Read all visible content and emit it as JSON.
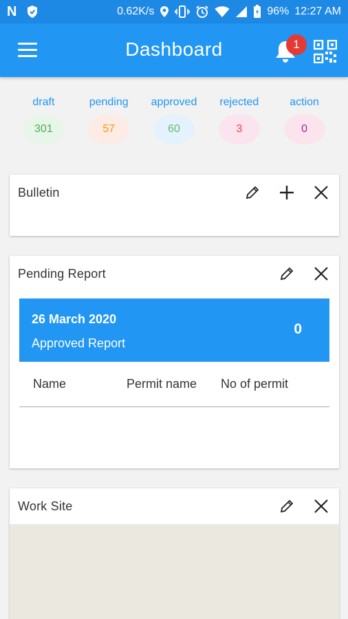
{
  "status_bar": {
    "speed": "0.62K/s",
    "battery": "96%",
    "time": "12:27 AM"
  },
  "app_bar": {
    "title": "Dashboard",
    "notification_count": "1"
  },
  "stats": [
    {
      "label": "draft",
      "value": "301",
      "label_color": "#2196f3",
      "value_color": "#4caf50",
      "bubble_color": "#e8f5e9"
    },
    {
      "label": "pending",
      "value": "57",
      "label_color": "#2196f3",
      "value_color": "#ff9800",
      "bubble_color": "#fdebe6"
    },
    {
      "label": "approved",
      "value": "60",
      "label_color": "#2196f3",
      "value_color": "#66bb6a",
      "bubble_color": "#e3f2fd"
    },
    {
      "label": "rejected",
      "value": "3",
      "label_color": "#2196f3",
      "value_color": "#f44336",
      "bubble_color": "#fbe4ee"
    },
    {
      "label": "action",
      "value": "0",
      "label_color": "#2196f3",
      "value_color": "#9c27b0",
      "bubble_color": "#fce4ec"
    }
  ],
  "cards": {
    "bulletin": {
      "title": "Bulletin"
    },
    "pending_report": {
      "title": "Pending Report",
      "banner_date": "26 March 2020",
      "banner_subtitle": "Approved Report",
      "banner_count": "0",
      "columns": [
        "Name",
        "Permit name",
        "No of permit"
      ]
    },
    "work_site": {
      "title": "Work Site"
    }
  },
  "colors": {
    "primary": "#2196f3",
    "status_bar": "#1e88e5",
    "badge": "#e53935"
  }
}
